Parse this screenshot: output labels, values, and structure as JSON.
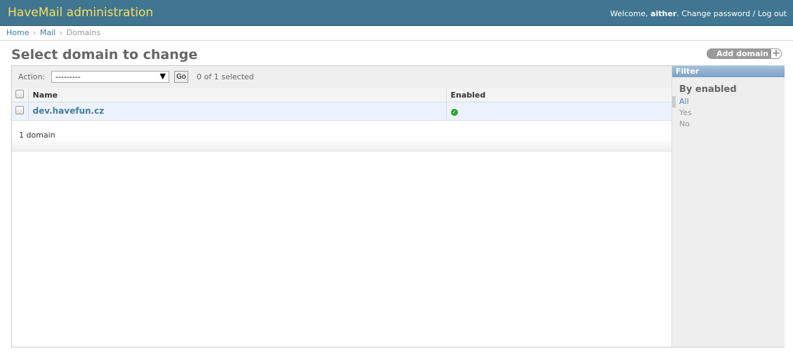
{
  "header": {
    "brand": "HaveMail administration",
    "welcome": "Welcome,",
    "username": "aither",
    "change_password": "Change password",
    "separator": "/",
    "logout": "Log out"
  },
  "breadcrumbs": {
    "home": "Home",
    "app": "Mail",
    "current": "Domains",
    "sep": "›"
  },
  "page": {
    "title": "Select domain to change",
    "add_button": "Add domain",
    "add_icon": "+"
  },
  "actions": {
    "label": "Action:",
    "selected": "---------",
    "go_label": "Go",
    "counter": "0 of 1 selected"
  },
  "table": {
    "columns": [
      "Name",
      "Enabled"
    ],
    "rows": [
      {
        "name": "dev.havefun.cz",
        "enabled": true
      }
    ]
  },
  "paginator": "1 domain",
  "filter": {
    "title": "Filter",
    "heading": "By enabled",
    "options": [
      "All",
      "Yes",
      "No"
    ],
    "selected": "All"
  },
  "colors": {
    "header_bg": "#417690",
    "brand": "#f5dd5d",
    "link": "#447e9b",
    "row_bg": "#edf3fe"
  }
}
